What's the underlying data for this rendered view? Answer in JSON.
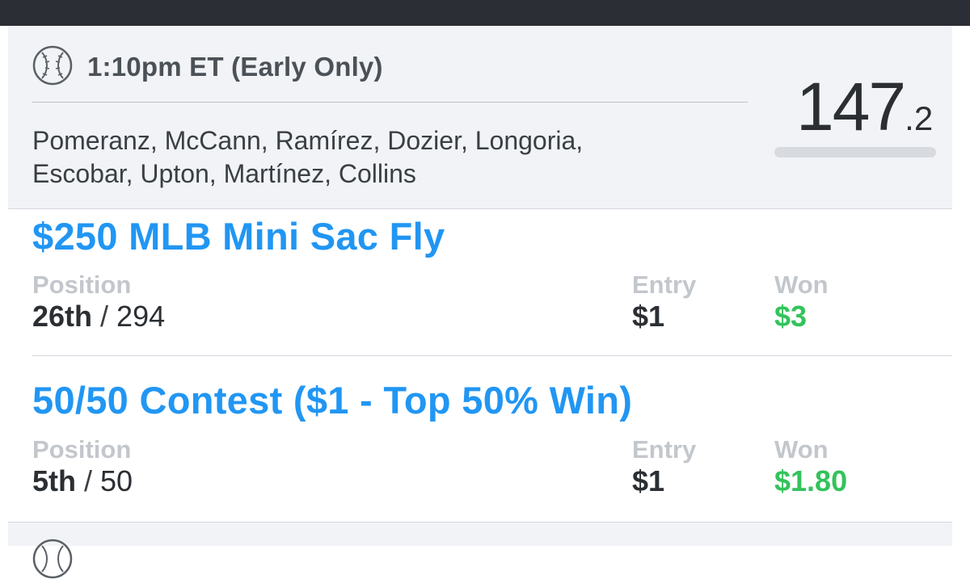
{
  "lineup": {
    "slate_time": "1:10pm ET (Early Only)",
    "players_line1": "Pomeranz, McCann, Ramírez, Dozier, Longoria,",
    "players_line2": "Escobar, Upton, Martínez, Collins",
    "score_integer": "147",
    "score_decimal": ".2",
    "score_bar_fill_fraction": 0.0,
    "icon": "baseball-icon"
  },
  "contests": [
    {
      "title": "$250 MLB Mini Sac Fly",
      "position_label": "Position",
      "position_rank": "26th",
      "position_total": "294",
      "entry_label": "Entry",
      "entry_value": "$1",
      "won_label": "Won",
      "won_value": "$3"
    },
    {
      "title": "50/50 Contest ($1 - Top 50% Win)",
      "position_label": "Position",
      "position_rank": "5th",
      "position_total": "50",
      "entry_label": "Entry",
      "entry_value": "$1",
      "won_label": "Won",
      "won_value": "$1.80"
    }
  ],
  "colors": {
    "title_blue": "#2196f3",
    "won_green": "#33c35c",
    "top_bar": "#2b2f35",
    "card_bg": "#f1f3f6"
  }
}
